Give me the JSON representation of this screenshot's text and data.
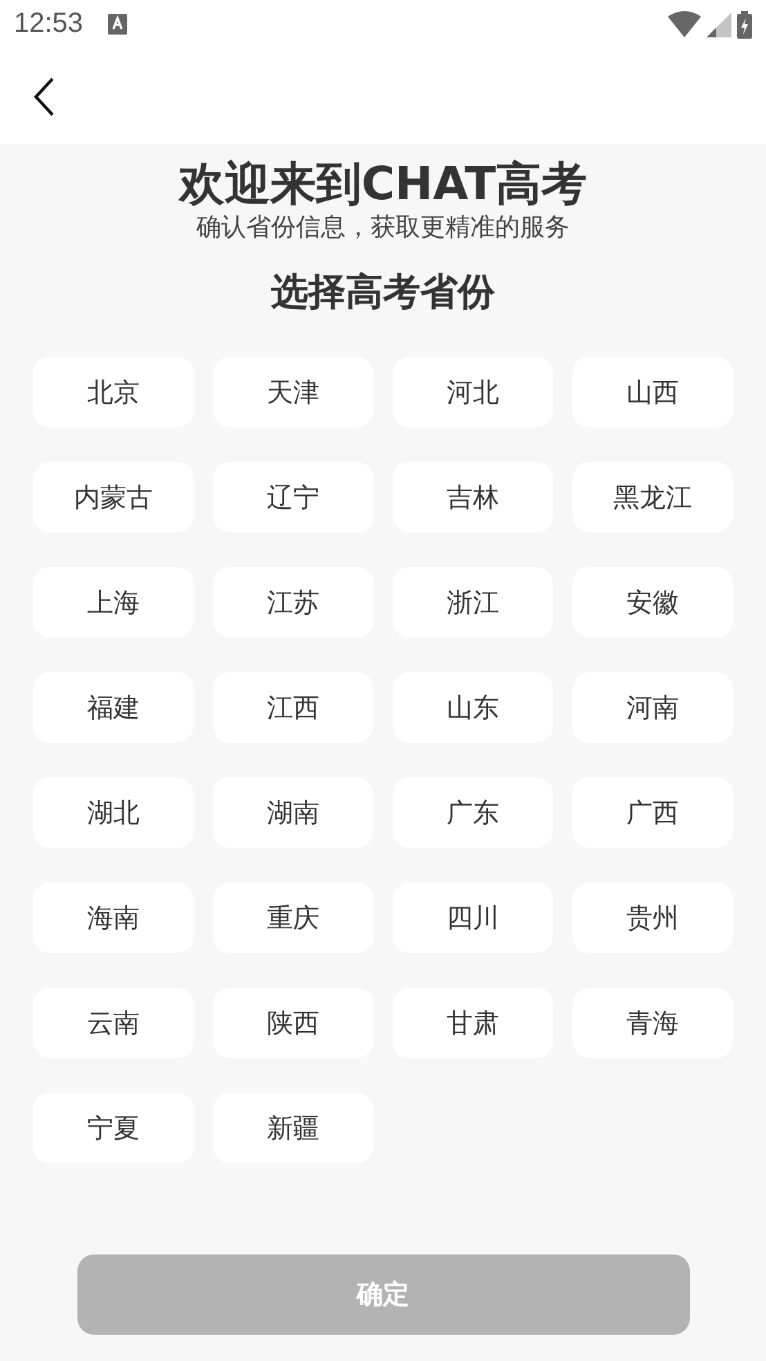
{
  "status_bar": {
    "time": "12:53"
  },
  "title": "欢迎来到CHAT高考",
  "subtitle": "确认省份信息，获取更精准的服务",
  "heading": "选择高考省份",
  "provinces": [
    {
      "label": "北京",
      "selected": false
    },
    {
      "label": "天津",
      "selected": false
    },
    {
      "label": "河北",
      "selected": false
    },
    {
      "label": "山西",
      "selected": false
    },
    {
      "label": "内蒙古",
      "selected": false
    },
    {
      "label": "辽宁",
      "selected": false
    },
    {
      "label": "吉林",
      "selected": false
    },
    {
      "label": "黑龙江",
      "selected": false
    },
    {
      "label": "上海",
      "selected": false
    },
    {
      "label": "江苏",
      "selected": false
    },
    {
      "label": "浙江",
      "selected": false
    },
    {
      "label": "安徽",
      "selected": false
    },
    {
      "label": "福建",
      "selected": false
    },
    {
      "label": "江西",
      "selected": false
    },
    {
      "label": "山东",
      "selected": false
    },
    {
      "label": "河南",
      "selected": false
    },
    {
      "label": "湖北",
      "selected": false
    },
    {
      "label": "湖南",
      "selected": false
    },
    {
      "label": "广东",
      "selected": false
    },
    {
      "label": "广西",
      "selected": false
    },
    {
      "label": "海南",
      "selected": false
    },
    {
      "label": "重庆",
      "selected": false
    },
    {
      "label": "四川",
      "selected": false
    },
    {
      "label": "贵州",
      "selected": false
    },
    {
      "label": "云南",
      "selected": false
    },
    {
      "label": "陕西",
      "selected": false
    },
    {
      "label": "甘肃",
      "selected": false
    },
    {
      "label": "青海",
      "selected": false
    },
    {
      "label": "宁夏",
      "selected": false
    },
    {
      "label": "新疆",
      "selected": false
    }
  ],
  "confirm_button": {
    "label": "确定",
    "disabled": true
  }
}
